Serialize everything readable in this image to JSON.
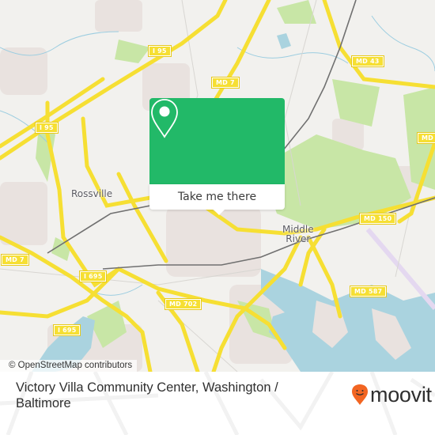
{
  "map": {
    "road_shields": [
      {
        "label": "I 95"
      },
      {
        "label": "I 95"
      },
      {
        "label": "MD 7"
      },
      {
        "label": "MD 43"
      },
      {
        "label": "MD"
      },
      {
        "label": "MD 7"
      },
      {
        "label": "I 695"
      },
      {
        "label": "I 695"
      },
      {
        "label": "MD 702"
      },
      {
        "label": "MD 150"
      },
      {
        "label": "MD 587"
      }
    ],
    "places": [
      {
        "name": "Rossville"
      },
      {
        "name": "Middle\nRiver"
      }
    ],
    "colors": {
      "land": "#f2f1ee",
      "water": "#aad3df",
      "park": "#c8e6a6",
      "residential": "#e9e2df",
      "highway": "#f6df33",
      "railway": "#707070"
    },
    "attribution": "© OpenStreetMap contributors"
  },
  "popup": {
    "icon": "location-pin-icon",
    "action_label": "Take me there",
    "accent_color": "#22b968"
  },
  "footer": {
    "title": "Victory Villa Community Center, Washington / Baltimore",
    "logo_text": "moovit",
    "logo_icon": "moovit-smiley-pin-icon",
    "logo_color": "#f26522"
  }
}
